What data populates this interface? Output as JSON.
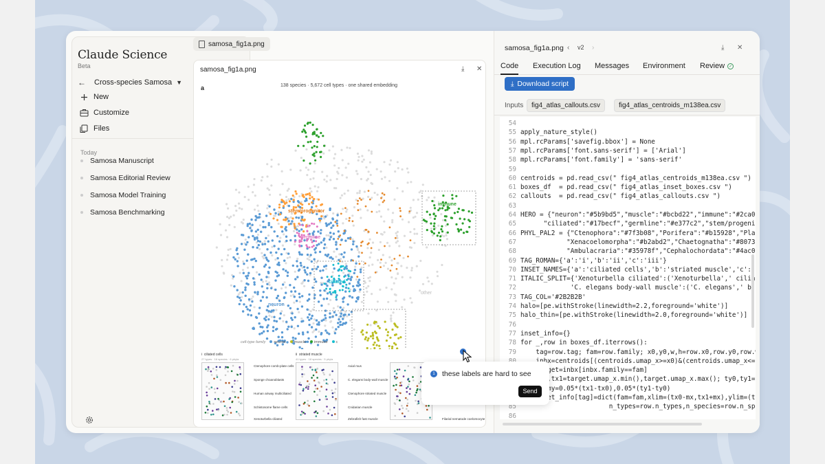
{
  "brand": {
    "name": "Claude Science",
    "beta": "Beta"
  },
  "sidebar": {
    "project": "Cross-species Samosa",
    "actions": [
      {
        "label": "New",
        "icon": "plus-icon"
      },
      {
        "label": "Customize",
        "icon": "briefcase-icon"
      },
      {
        "label": "Files",
        "icon": "files-icon"
      }
    ],
    "history_header": "Today",
    "history": [
      "Samosa Manuscript",
      "Samosa Editorial Review",
      "Samosa Model Training",
      "Samosa Benchmarking"
    ]
  },
  "file_tab": "samosa_fig1a.png",
  "preview": {
    "title": "samosa_fig1a.png",
    "panel_letter": "a",
    "subtitle": "138 species · 5,672 cell types · one shared embedding",
    "cluster_labels": [
      "stem/progenitor",
      "immune",
      "germline",
      "ciliated",
      "neuron",
      "muscle",
      "other"
    ],
    "legend_title": "cell-type family",
    "legend": [
      {
        "label": "neuron",
        "color": "#5b9bd5"
      },
      {
        "label": "muscle",
        "color": "#bcbd22"
      },
      {
        "label": "immune",
        "color": "#2ca02c"
      },
      {
        "label": "c",
        "color": "#17becf"
      }
    ],
    "insets": [
      {
        "tag": "i",
        "title": "ciliated cells",
        "sub": "27 types · 16 species · 6 phyla",
        "labels": [
          "Ctenophore comb-plate cells",
          "Sponge choanoblasts",
          "Human airway multiciliated",
          "Schistosome flame cells",
          "Xenoturbella ciliated"
        ]
      },
      {
        "tag": "ii",
        "title": "striated muscle",
        "sub": "41 types · 18 species · 5 phyla",
        "labels": [
          "Axial mus",
          "C. elegans body-wall muscle",
          "Ctenophore striated muscle",
          "Cnidarian muscle",
          "Zebrafish fast muscle"
        ]
      },
      {
        "tag": "iii",
        "title": "",
        "sub": "",
        "labels": [
          "Arrow worm haemocytes",
          "Coral myeloid",
          "Oyster haemocytes",
          "Filarial nematode coelomocyte"
        ]
      }
    ],
    "comment": {
      "number": "1",
      "text": "these labels are hard to see",
      "send": "Send"
    }
  },
  "code_panel": {
    "title": "samosa_fig1a.png",
    "version": "v2",
    "tabs": [
      "Code",
      "Execution Log",
      "Messages",
      "Environment",
      "Review"
    ],
    "download": "Download script",
    "inputs_label": "Inputs",
    "inputs": [
      "fig4_atlas_callouts.csv",
      "fig4_atlas_centroids_m138ea.csv"
    ],
    "lines": [
      {
        "n": "54",
        "t": ""
      },
      {
        "n": "55",
        "t": "apply_nature_style()"
      },
      {
        "n": "56",
        "t": "mpl.rcParams['savefig.bbox'] = None"
      },
      {
        "n": "57",
        "t": "mpl.rcParams['font.sans-serif'] = ['Arial']"
      },
      {
        "n": "58",
        "t": "mpl.rcParams['font.family'] = 'sans-serif'"
      },
      {
        "n": "59",
        "t": ""
      },
      {
        "n": "60",
        "t": "centroids = pd.read_csv(\" fig4_atlas_centroids_m138ea.csv \")"
      },
      {
        "n": "61",
        "t": "boxes_df  = pd.read_csv(\" fig4_atlas_inset_boxes.csv \")"
      },
      {
        "n": "62",
        "t": "callouts  = pd.read_csv(\" fig4_atlas_callouts.csv \")"
      },
      {
        "n": "63",
        "t": ""
      },
      {
        "n": "64",
        "t": "HERO = {\"neuron\":\"#5b9bd5\",\"muscle\":\"#bcbd22\",\"immune\":\"#2ca02c"
      },
      {
        "n": "65",
        "t": "      \"ciliated\":\"#17becf\",\"germline\":\"#e377c2\",\"stem/progeni"
      },
      {
        "n": "66",
        "t": "PHYL_PAL2 = {\"Ctenophora\":\"#7f3b08\",\"Porifera\":\"#b15928\",\"Plac"
      },
      {
        "n": "67",
        "t": "            \"Xenacoelomorpha\":\"#b2abd2\",\"Chaetognatha\":\"#8073"
      },
      {
        "n": "68",
        "t": "            \"Ambulacraria\":\"#35978f\",\"Cephalochordata\":\"#4ac0"
      },
      {
        "n": "69",
        "t": "TAG_ROMAN={'a':'i','b':'ii','c':'iii'}"
      },
      {
        "n": "70",
        "t": "INSET_NAMES={'a':'ciliated cells','b':'striated muscle','c':'"
      },
      {
        "n": "71",
        "t": "ITALIC_SPLIT={'Xenoturbella ciliated':('Xenoturbella',' cilia"
      },
      {
        "n": "72",
        "t": "             'C. elegans body-wall muscle':('C. elegans',' b"
      },
      {
        "n": "73",
        "t": "TAG_COL='#2B2B2B'"
      },
      {
        "n": "74",
        "t": "halo=[pe.withStroke(linewidth=2.2,foreground='white')]"
      },
      {
        "n": "75",
        "t": "halo_thin=[pe.withStroke(linewidth=2.0,foreground='white')]"
      },
      {
        "n": "76",
        "t": ""
      },
      {
        "n": "77",
        "t": "inset_info={}"
      },
      {
        "n": "78",
        "t": "for _,row in boxes_df.iterrows():"
      },
      {
        "n": "79",
        "t": "    tag=row.tag; fam=row.family; x0,y0,w,h=row.x0,row.y0,row.w"
      },
      {
        "n": "80",
        "t": "    inbx=centroids[(centroids.umap_x>=x0)&(centroids.umap_x<="
      },
      {
        "n": "81",
        "t": "    target=inbx[inbx.family==fam]"
      },
      {
        "n": "82",
        "t": "    tx0,tx1=target.umap_x.min(),target.umap_x.max(); ty0,ty1=ta"
      },
      {
        "n": "83",
        "t": "    mx,my=0.05*(tx1-tx0),0.05*(ty1-ty0)"
      },
      {
        "n": "84",
        "t": "    inset_info[tag]=dict(fam=fam,xlim=(tx0-mx,tx1+mx),ylim=(ty("
      },
      {
        "n": "85",
        "t": "                       n_types=row.n_types,n_species=row.n_sp"
      },
      {
        "n": "86",
        "t": ""
      }
    ]
  }
}
